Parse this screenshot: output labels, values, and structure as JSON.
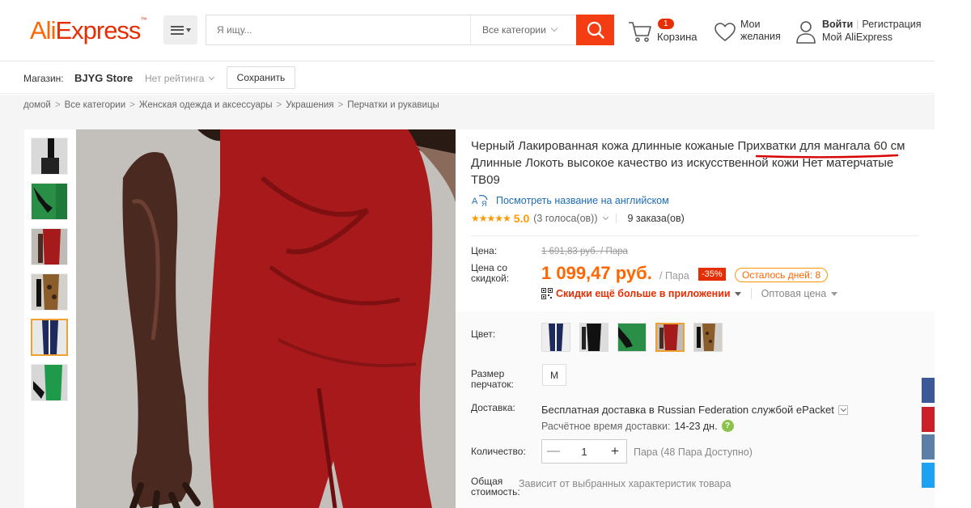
{
  "header": {
    "logo_part1": "Ali",
    "logo_part2": "Express",
    "logo_tm": "™",
    "search_placeholder": "Я ищу...",
    "category_select": "Все категории",
    "cart_count": "1",
    "cart_label": "Корзина",
    "wishlist_line1": "Мои",
    "wishlist_line2": "желания",
    "login": "Войти",
    "register": "Регистрация",
    "my_account": "Мой AliExpress"
  },
  "store": {
    "label": "Магазин:",
    "name": "BJYG Store",
    "rating": "Нет рейтинга",
    "save_button": "Сохранить"
  },
  "breadcrumb": [
    "домой",
    "Все категории",
    "Женская одежда и аксессуары",
    "Украшения",
    "Перчатки и рукавицы"
  ],
  "product": {
    "title": "Черный Лакированная кожа длинные кожаные Прихватки для мангала 60 см Длинные Локоть высокое качество из искусственной кожи Нет матерчатые TB09",
    "translate_link": "Посмотреть название на английском",
    "stars": "★★★★★",
    "rating": "5.0",
    "votes": "(3 голоса(ов))",
    "orders": "9 заказа(ов)",
    "price_label": "Цена:",
    "old_price": "1 691,83 руб. / Пара",
    "discount_price_label_1": "Цена со",
    "discount_price_label_2": "скидкой:",
    "new_price": "1 099,47 руб.",
    "per_unit": "/ Пара",
    "discount": "-35%",
    "days_left": "Осталось дней: 8",
    "app_discount": "Скидки ещё больше в приложении",
    "wholesale": "Оптовая цена",
    "color_label": "Цвет:",
    "size_label_1": "Размер",
    "size_label_2": "перчаток:",
    "size_value": "M",
    "delivery_label": "Доставка:",
    "delivery_text": "Бесплатная доставка в Russian Federation службой ePacket",
    "delivery_time_label": "Расчётное время доставки:",
    "delivery_time": "14-23 дн.",
    "delivery_help": "?",
    "quantity_label": "Количество:",
    "quantity_value": "1",
    "quantity_minus": "—",
    "quantity_plus": "+",
    "available": "Пара (48 Пара Доступно)",
    "total_label_1": "Общая",
    "total_label_2": "стоимость:",
    "total_note": "Зависит от выбранных характеристик товара"
  },
  "colors": {
    "brand_orange": "#f60",
    "brand_red": "#e62e04",
    "search_button": "#f53d13",
    "link_blue": "#1f6db5",
    "star": "#f90"
  },
  "social_buttons": [
    "facebook-icon",
    "pinterest-icon",
    "vk-icon",
    "twitter-icon"
  ]
}
